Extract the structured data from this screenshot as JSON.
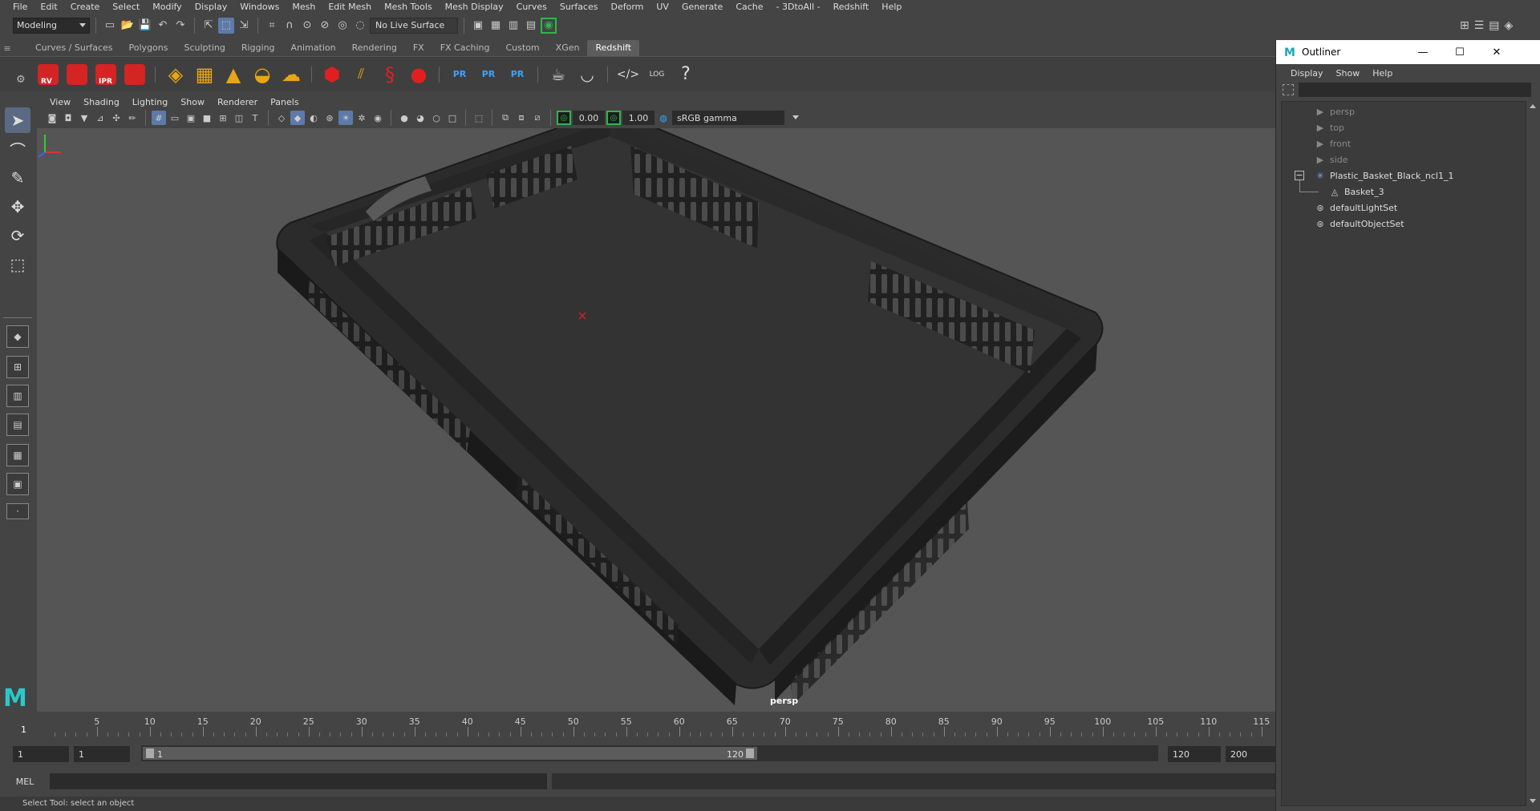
{
  "menubar": {
    "items": [
      "File",
      "Edit",
      "Create",
      "Select",
      "Modify",
      "Display",
      "Windows",
      "Mesh",
      "Edit Mesh",
      "Mesh Tools",
      "Mesh Display",
      "Curves",
      "Surfaces",
      "Deform",
      "UV",
      "Generate",
      "Cache",
      "- 3DtoAll -",
      "Redshift",
      "Help"
    ]
  },
  "statusline": {
    "mode": "Modeling",
    "live_surface": "No Live Surface"
  },
  "shelf": {
    "tabs": [
      "Curves / Surfaces",
      "Polygons",
      "Sculpting",
      "Rigging",
      "Animation",
      "Rendering",
      "FX",
      "FX Caching",
      "Custom",
      "XGen",
      "Redshift"
    ],
    "active_tab": "Redshift",
    "buttons": {
      "rv": "RV",
      "ipr": "IPR",
      "pr1": "PR",
      "pr2": "PR",
      "pr3": "PR",
      "log": "LOG",
      "help": "?"
    }
  },
  "panel": {
    "menu": [
      "View",
      "Shading",
      "Lighting",
      "Show",
      "Renderer",
      "Panels"
    ],
    "exposure": "0.00",
    "gamma_value": "1.00",
    "color_space": "sRGB gamma",
    "camera_label": "persp"
  },
  "timeslider": {
    "current_frame": "1",
    "tick_labels": [
      "5",
      "10",
      "15",
      "20",
      "25",
      "30",
      "35",
      "40",
      "45",
      "50",
      "55",
      "60",
      "65",
      "70",
      "75",
      "80",
      "85",
      "90",
      "95",
      "100",
      "105",
      "110",
      "115"
    ]
  },
  "range": {
    "start_field": "1",
    "current_field": "1",
    "range_start": "1",
    "range_end": "120",
    "end_field": "120",
    "anim_end_field": "200"
  },
  "cmdline": {
    "lang": "MEL"
  },
  "helpline": {
    "text": "Select Tool: select an object"
  },
  "outliner": {
    "title": "Outliner",
    "menu": [
      "Display",
      "Show",
      "Help"
    ],
    "items": [
      {
        "label": "persp",
        "icon": "camera-icon",
        "dim": true
      },
      {
        "label": "top",
        "icon": "camera-icon",
        "dim": true
      },
      {
        "label": "front",
        "icon": "camera-icon",
        "dim": true
      },
      {
        "label": "side",
        "icon": "camera-icon",
        "dim": true
      },
      {
        "label": "Plastic_Basket_Black_ncl1_1",
        "icon": "group-icon",
        "dim": false
      },
      {
        "label": "Basket_3",
        "icon": "mesh-icon",
        "dim": false
      },
      {
        "label": "defaultLightSet",
        "icon": "set-icon",
        "dim": false
      },
      {
        "label": "defaultObjectSet",
        "icon": "set-icon",
        "dim": false
      }
    ]
  },
  "colors": {
    "viewport_bg": "#555555",
    "accent_active": "#5d7aa8",
    "redshift_red": "#d42424",
    "maya_teal": "#2cc8c8"
  }
}
